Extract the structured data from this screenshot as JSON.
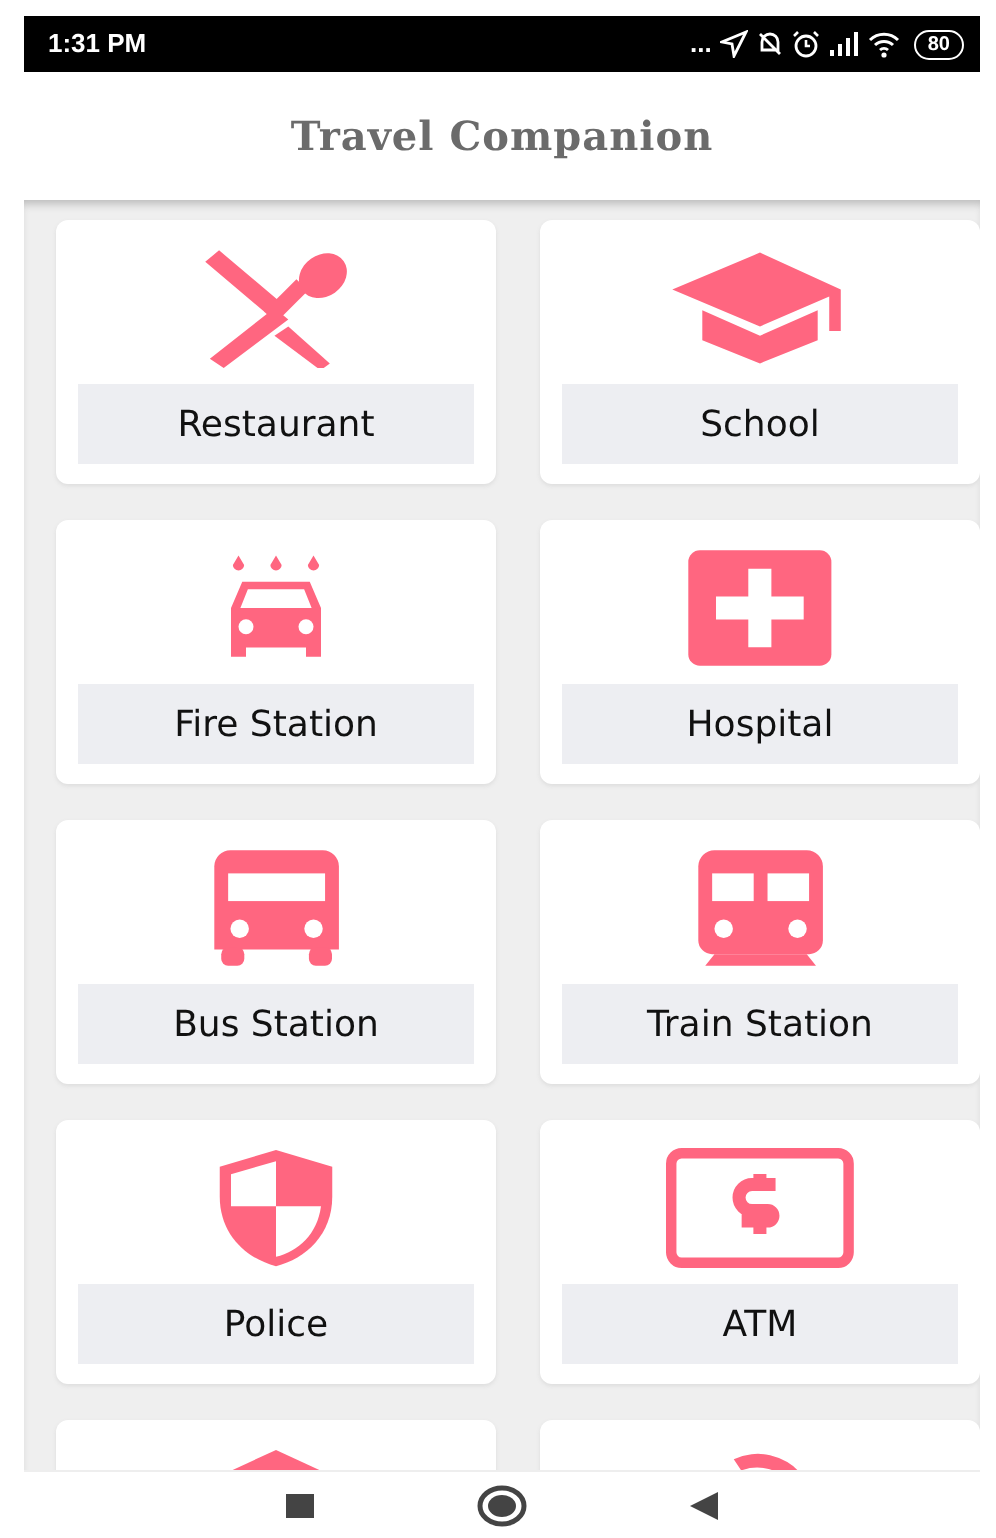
{
  "status_bar": {
    "time": "1:31 PM",
    "more": "...",
    "battery": "80"
  },
  "app_bar": {
    "title": "Travel Companion"
  },
  "places": [
    {
      "label": "Restaurant",
      "kind": "restaurant"
    },
    {
      "label": "School",
      "kind": "school"
    },
    {
      "label": "Fire Station",
      "kind": "fire"
    },
    {
      "label": "Hospital",
      "kind": "hospital"
    },
    {
      "label": "Bus Station",
      "kind": "bus"
    },
    {
      "label": "Train Station",
      "kind": "train"
    },
    {
      "label": "Police",
      "kind": "police"
    },
    {
      "label": "ATM",
      "kind": "atm"
    },
    {
      "kind": "roof"
    },
    {
      "kind": "arc"
    }
  ]
}
